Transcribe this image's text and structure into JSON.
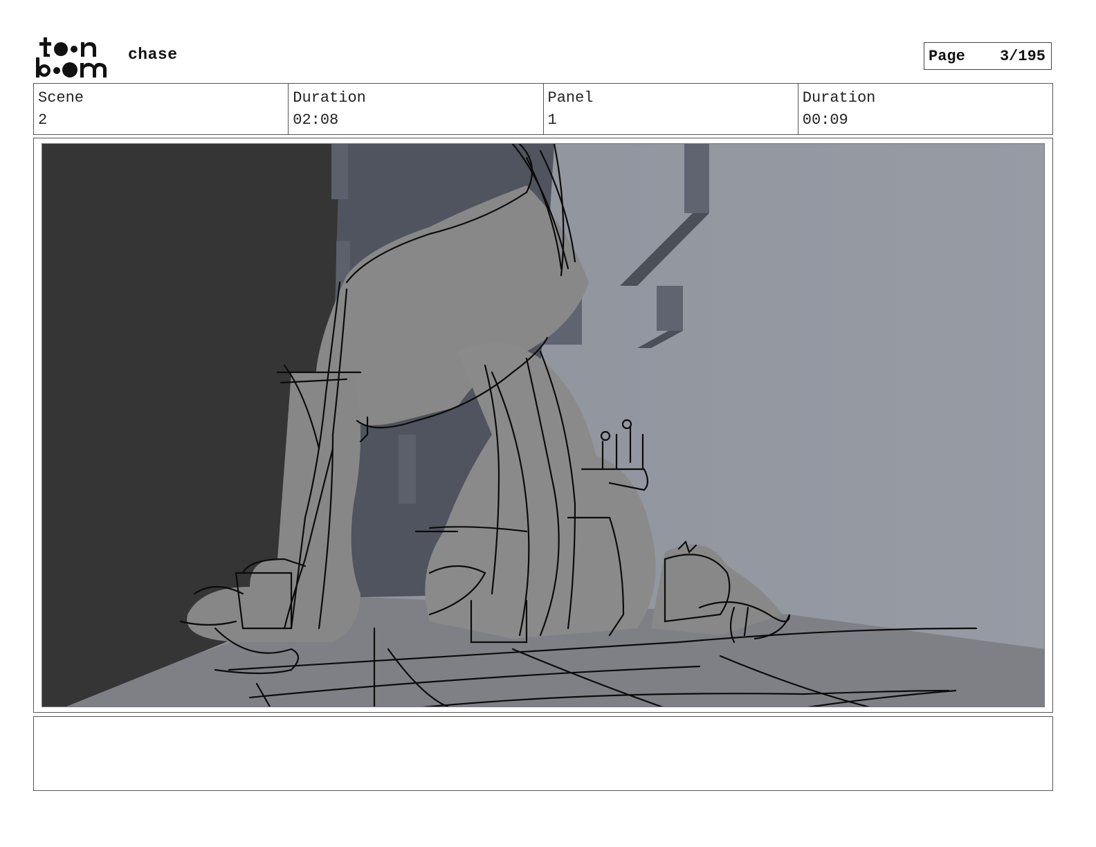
{
  "header": {
    "logo": {
      "icon": "toon-boom-logo",
      "top_text": "t●●n",
      "bottom_text": "b●●m"
    },
    "project_title": "chase",
    "page": {
      "label": "Page",
      "value": "3/195"
    }
  },
  "info": {
    "scene_label": "Scene",
    "scene_value": "2",
    "scene_duration_label": "Duration",
    "scene_duration_value": "02:08",
    "panel_label": "Panel",
    "panel_value": "1",
    "panel_duration_label": "Duration",
    "panel_duration_value": "00:09"
  },
  "panel": {
    "image": "storyboard-sketch",
    "colors": {
      "dark_wall": "#343434",
      "back_wall": "#8f939c",
      "floor": "#7e7f85",
      "shadow": "#4f545e",
      "sketch_fill": "#8a8a8a",
      "ink": "#0b0b0b"
    }
  },
  "notes": {
    "text": ""
  }
}
